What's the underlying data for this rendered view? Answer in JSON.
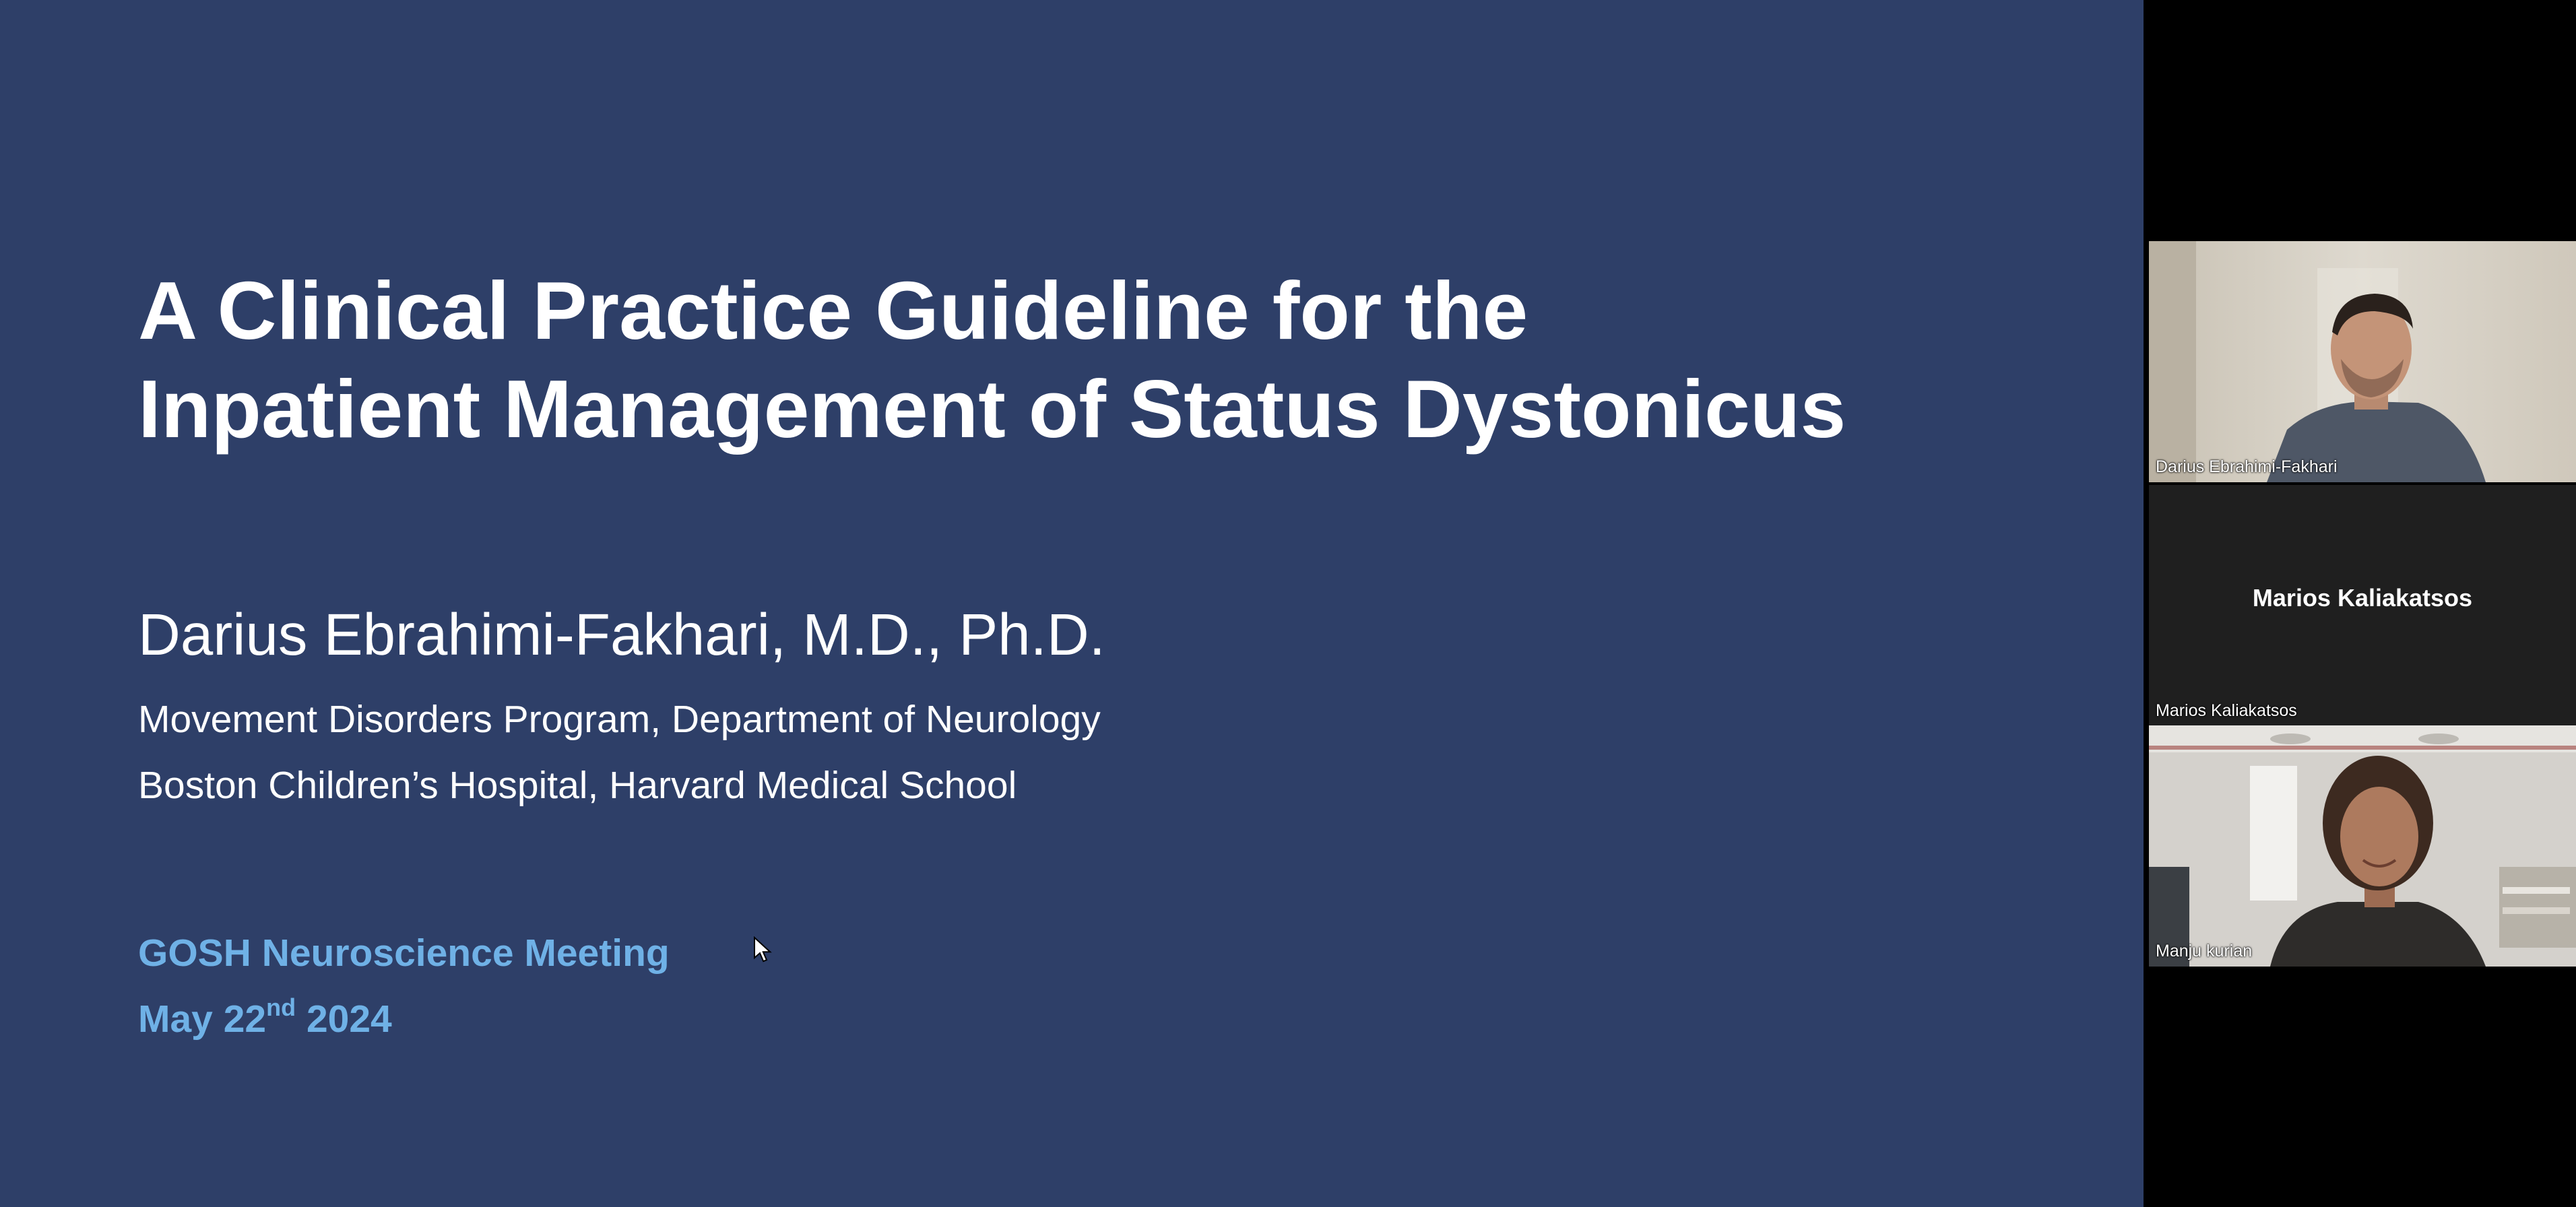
{
  "slide": {
    "title_line1": "A Clinical Practice Guideline for the",
    "title_line2": "Inpatient Management of Status Dystonicus",
    "presenter": "Darius Ebrahimi-Fakhari, M.D., Ph.D.",
    "affiliation_line1": "Movement Disorders Program, Department of Neurology",
    "affiliation_line2": "Boston Children’s Hospital, Harvard Medical School",
    "event_name": "GOSH Neuroscience Meeting",
    "event_date_prefix": "May 22",
    "event_date_sup": "nd",
    "event_date_suffix": " 2024",
    "colors": {
      "background": "#2e3f68",
      "title_text": "#ffffff",
      "event_text": "#6fb1e6"
    }
  },
  "participants": [
    {
      "name": "Darius Ebrahimi-Fakhari",
      "video": "on"
    },
    {
      "name": "Marios Kaliakatsos",
      "video": "off"
    },
    {
      "name": "Manju kurian",
      "video": "on"
    }
  ],
  "icons": {
    "cursor": "mouse-pointer-icon"
  }
}
